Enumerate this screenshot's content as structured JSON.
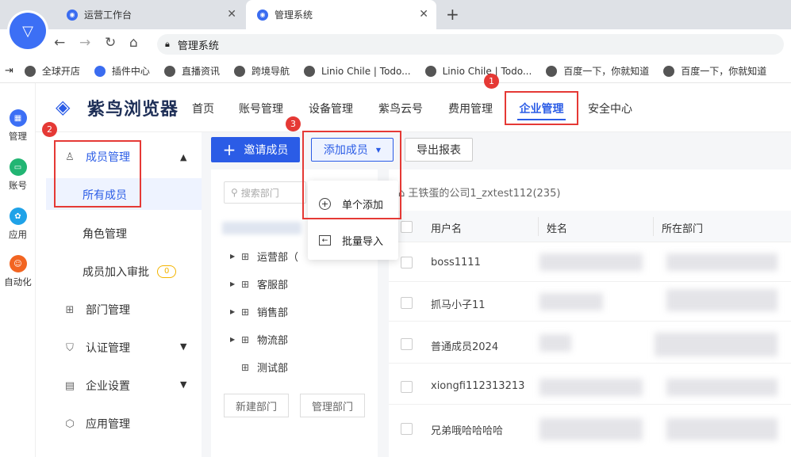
{
  "browser": {
    "tabs": [
      {
        "label": "运营工作台"
      },
      {
        "label": "管理系统"
      }
    ],
    "address": "管理系统",
    "bookmarks": [
      "全球开店",
      "插件中心",
      "直播资讯",
      "跨境导航",
      "Linio Chile | Todo...",
      "Linio Chile | Todo...",
      "百度一下，你就知道",
      "百度一下，你就知道"
    ]
  },
  "rail": [
    {
      "label": "管理",
      "color": "#3c6ff5"
    },
    {
      "label": "账号",
      "color": "#22b573"
    },
    {
      "label": "应用",
      "color": "#1fa2e8"
    },
    {
      "label": "自动化",
      "color": "#f26522"
    }
  ],
  "app": {
    "logo": "紫鸟浏览器",
    "nav": [
      "首页",
      "账号管理",
      "设备管理",
      "紫鸟云号",
      "费用管理",
      "企业管理",
      "安全中心"
    ]
  },
  "badges": [
    "1",
    "2",
    "3"
  ],
  "sidebar": {
    "member_mgmt": "成员管理",
    "all_members": "所有成员",
    "role_mgmt": "角色管理",
    "join_review": "成员加入审批",
    "join_review_count": "0",
    "dept_mgmt": "部门管理",
    "auth_mgmt": "认证管理",
    "ent_settings": "企业设置",
    "app_mgmt": "应用管理"
  },
  "toolbar": {
    "invite": "邀请成员",
    "add": "添加成员",
    "export": "导出报表"
  },
  "dropdown": {
    "single": "单个添加",
    "batch": "批量导入"
  },
  "dept": {
    "search_placeholder": "搜索部门",
    "items": [
      "运营部（",
      "客服部",
      "销售部",
      "物流部",
      "测试部"
    ],
    "new_btn": "新建部门",
    "manage_btn": "管理部门"
  },
  "table": {
    "company": "王铁蛋的公司1_zxtest112(235)",
    "columns": [
      "用户名",
      "姓名",
      "所在部门"
    ],
    "rows": [
      "boss1111",
      "抓马小子11",
      "普通成员2024",
      "xiongfi112313213",
      "兄弟哦哈哈哈哈"
    ]
  }
}
